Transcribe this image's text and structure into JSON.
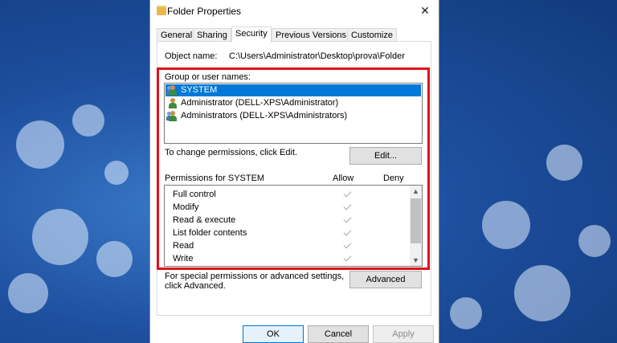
{
  "window": {
    "title": "Folder Properties"
  },
  "tabs": [
    {
      "label": "General"
    },
    {
      "label": "Sharing"
    },
    {
      "label": "Security"
    },
    {
      "label": "Previous Versions"
    },
    {
      "label": "Customize"
    }
  ],
  "object": {
    "label": "Object name:",
    "value": "C:\\Users\\Administrator\\Desktop\\prova\\Folder"
  },
  "groups": {
    "label": "Group or user names:",
    "items": [
      {
        "name": "SYSTEM",
        "selected": true,
        "icon": "group-users-icon"
      },
      {
        "name": "Administrator (DELL-XPS\\Administrator)",
        "selected": false,
        "icon": "user-icon"
      },
      {
        "name": "Administrators (DELL-XPS\\Administrators)",
        "selected": false,
        "icon": "group-users-icon"
      }
    ]
  },
  "change_text": "To change permissions, click Edit.",
  "edit_label": "Edit...",
  "permissions": {
    "header": "Permissions for SYSTEM",
    "allow_label": "Allow",
    "deny_label": "Deny",
    "rows": [
      {
        "name": "Full control",
        "allow": true,
        "deny": false
      },
      {
        "name": "Modify",
        "allow": true,
        "deny": false
      },
      {
        "name": "Read & execute",
        "allow": true,
        "deny": false
      },
      {
        "name": "List folder contents",
        "allow": true,
        "deny": false
      },
      {
        "name": "Read",
        "allow": true,
        "deny": false
      },
      {
        "name": "Write",
        "allow": true,
        "deny": false
      }
    ]
  },
  "advanced": {
    "text_line1": "For special permissions or advanced settings,",
    "text_line2": "click Advanced.",
    "button": "Advanced"
  },
  "footer": {
    "ok": "OK",
    "cancel": "Cancel",
    "apply": "Apply"
  },
  "colors": {
    "selection": "#0078d7",
    "highlight_box": "#e0101a"
  }
}
